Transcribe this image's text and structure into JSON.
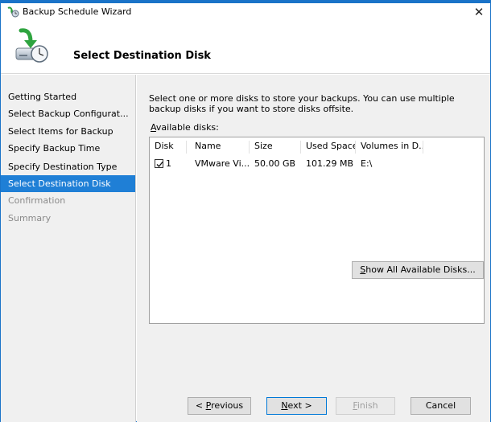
{
  "window": {
    "title": "Backup Schedule Wizard",
    "close_glyph": "✕"
  },
  "header": {
    "title": "Select Destination Disk",
    "icon": "backup-wizard-icon"
  },
  "sidebar": {
    "items": [
      {
        "label": "Getting Started",
        "state": "normal"
      },
      {
        "label": "Select Backup Configurat...",
        "state": "normal"
      },
      {
        "label": "Select Items for Backup",
        "state": "normal"
      },
      {
        "label": "Specify Backup Time",
        "state": "normal"
      },
      {
        "label": "Specify Destination Type",
        "state": "normal"
      },
      {
        "label": "Select Destination Disk",
        "state": "active"
      },
      {
        "label": "Confirmation",
        "state": "disabled"
      },
      {
        "label": "Summary",
        "state": "disabled"
      }
    ]
  },
  "content": {
    "description": "Select one or more disks to store your backups. You can use multiple backup disks if you want to store disks offsite.",
    "available_label_accel": "A",
    "available_label_rest": "vailable disks:",
    "columns": [
      "Disk",
      "Name",
      "Size",
      "Used Space",
      "Volumes in D..."
    ],
    "rows": [
      {
        "checked": true,
        "disk": "1",
        "name": "VMware Vi...",
        "size": "50.00 GB",
        "used": "101.29 MB",
        "volumes": "E:\\"
      }
    ],
    "show_all_accel": "S",
    "show_all_rest": "how All Available Disks..."
  },
  "buttons": {
    "previous_pre": "< ",
    "previous_accel": "P",
    "previous_rest": "revious",
    "next_accel": "N",
    "next_rest": "ext >",
    "finish_accel": "F",
    "finish_rest": "inish",
    "cancel": "Cancel"
  },
  "colors": {
    "accent": "#1f7fd6",
    "window_border": "#1a73c8",
    "panel_bg": "#f0f0f0"
  }
}
